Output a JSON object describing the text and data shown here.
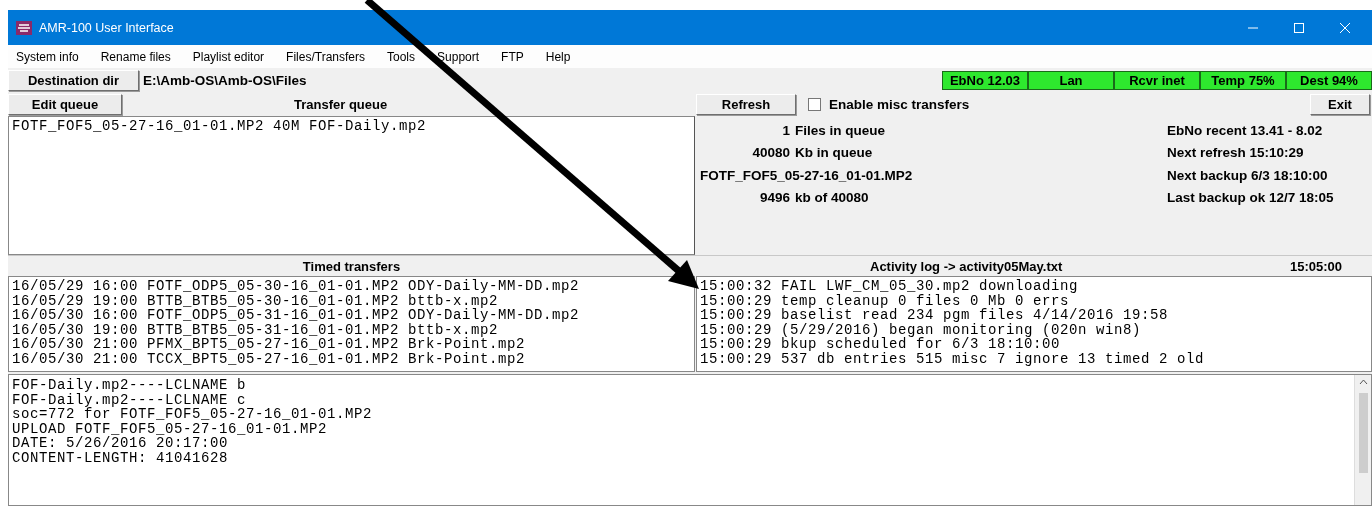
{
  "window": {
    "title": "AMR-100 User Interface"
  },
  "menu": [
    "System info",
    "Rename files",
    "Playlist editor",
    "Files/Transfers",
    "Tools",
    "Support",
    "FTP",
    "Help"
  ],
  "destination": {
    "button": "Destination dir",
    "path": "E:\\Amb-OS\\Amb-OS\\Files"
  },
  "status_indicators": [
    {
      "label": "EbNo 12.03",
      "color": "#2ee82e"
    },
    {
      "label": "Lan",
      "color": "#2ee82e"
    },
    {
      "label": "Rcvr inet",
      "color": "#2ee82e"
    },
    {
      "label": "Temp 75%",
      "color": "#2ee82e"
    },
    {
      "label": "Dest 94%",
      "color": "#2ee82e"
    }
  ],
  "edit_queue_button": "Edit queue",
  "transfer_queue": {
    "title": "Transfer queue",
    "lines": [
      "FOTF_FOF5_05-27-16_01-01.MP2 40M FOF-Daily.mp2"
    ]
  },
  "refresh_button": "Refresh",
  "misc_transfers": {
    "label": "Enable misc transfers",
    "checked": false
  },
  "exit_button": "Exit",
  "files_in_queue": {
    "value": "1",
    "label": "Files in queue"
  },
  "kb_in_queue": {
    "value": "40080",
    "label": "Kb in queue"
  },
  "current_file": "FOTF_FOF5_05-27-16_01-01.MP2",
  "file_progress": {
    "value": "9496",
    "label": "kb of 40080"
  },
  "status_info": [
    "EbNo recent 13.41 - 8.02",
    "Next refresh 15:10:29",
    "Next backup 6/3 18:10:00",
    "Last backup ok 12/7 18:05"
  ],
  "timed_transfers": {
    "title": "Timed transfers",
    "lines": [
      "16/05/29 16:00 FOTF_ODP5_05-30-16_01-01.MP2 ODY-Daily-MM-DD.mp2",
      "16/05/29 19:00 BTTB_BTB5_05-30-16_01-01.MP2 bttb-x.mp2",
      "16/05/30 16:00 FOTF_ODP5_05-31-16_01-01.MP2 ODY-Daily-MM-DD.mp2",
      "16/05/30 19:00 BTTB_BTB5_05-31-16_01-01.MP2 bttb-x.mp2",
      "16/05/30 21:00 PFMX_BPT5_05-27-16_01-01.MP2 Brk-Point.mp2",
      "16/05/30 21:00 TCCX_BPT5_05-27-16_01-01.MP2 Brk-Point.mp2"
    ]
  },
  "activity_log": {
    "title": "Activity log -> activity05May.txt",
    "time": "15:05:00",
    "lines": [
      "15:00:32 FAIL LWF_CM_05_30.mp2 downloading",
      "15:00:29 temp cleanup 0 files 0 Mb 0 errs",
      "15:00:29 baselist read 234 pgm files 4/14/2016 19:58",
      "15:00:29 (5/29/2016) began monitoring (020n win8)",
      "15:00:29 bkup scheduled for 6/3 18:10:00",
      "15:00:29 537 db entries 515 misc 7 ignore 13 timed 2 old"
    ]
  },
  "output_log": {
    "lines": [
      "FOF-Daily.mp2----LCLNAME b",
      "FOF-Daily.mp2----LCLNAME c",
      "soc=772 for FOTF_FOF5_05-27-16_01-01.MP2",
      "UPLOAD FOTF_FOF5_05-27-16_01-01.MP2",
      "DATE: 5/26/2016 20:17:00",
      "CONTENT-LENGTH: 41041628"
    ]
  }
}
